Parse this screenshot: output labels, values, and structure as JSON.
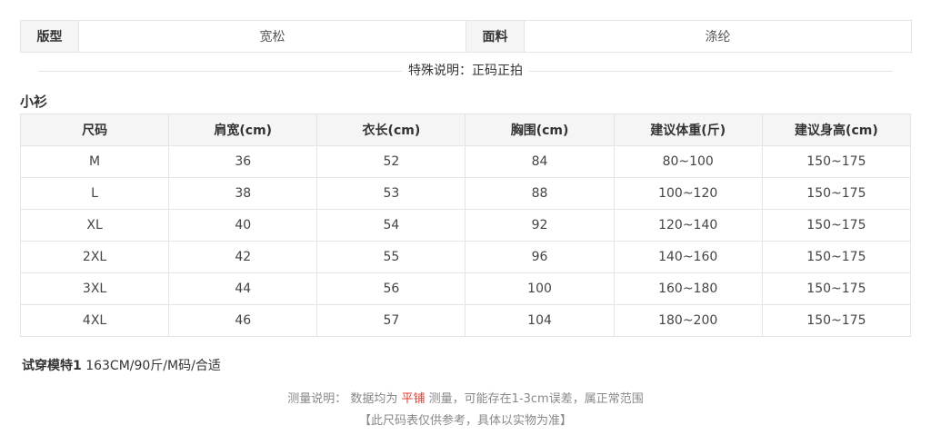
{
  "attributes": {
    "fit_label": "版型",
    "fit_value": "宽松",
    "fabric_label": "面料",
    "fabric_value": "涤纶"
  },
  "special_note": "特殊说明：正码正拍",
  "section_title": "小衫",
  "size_table": {
    "headers": [
      "尺码",
      "肩宽(cm)",
      "衣长(cm)",
      "胸围(cm)",
      "建议体重(斤)",
      "建议身高(cm)"
    ],
    "rows": [
      [
        "M",
        "36",
        "52",
        "84",
        "80~100",
        "150~175"
      ],
      [
        "L",
        "38",
        "53",
        "88",
        "100~120",
        "150~175"
      ],
      [
        "XL",
        "40",
        "54",
        "92",
        "120~140",
        "150~175"
      ],
      [
        "2XL",
        "42",
        "55",
        "96",
        "140~160",
        "150~175"
      ],
      [
        "3XL",
        "44",
        "56",
        "100",
        "160~180",
        "150~175"
      ],
      [
        "4XL",
        "46",
        "57",
        "104",
        "180~200",
        "150~175"
      ]
    ]
  },
  "model": {
    "label": "试穿模特1",
    "info": " 163CM/90斤/M码/合适"
  },
  "footer": {
    "prefix": "测量说明：  数据均为 ",
    "highlight": "平铺",
    "suffix": " 测量，可能存在1-3cm误差，属正常范围",
    "line2": "【此尺码表仅供参考，具体以实物为准】"
  }
}
